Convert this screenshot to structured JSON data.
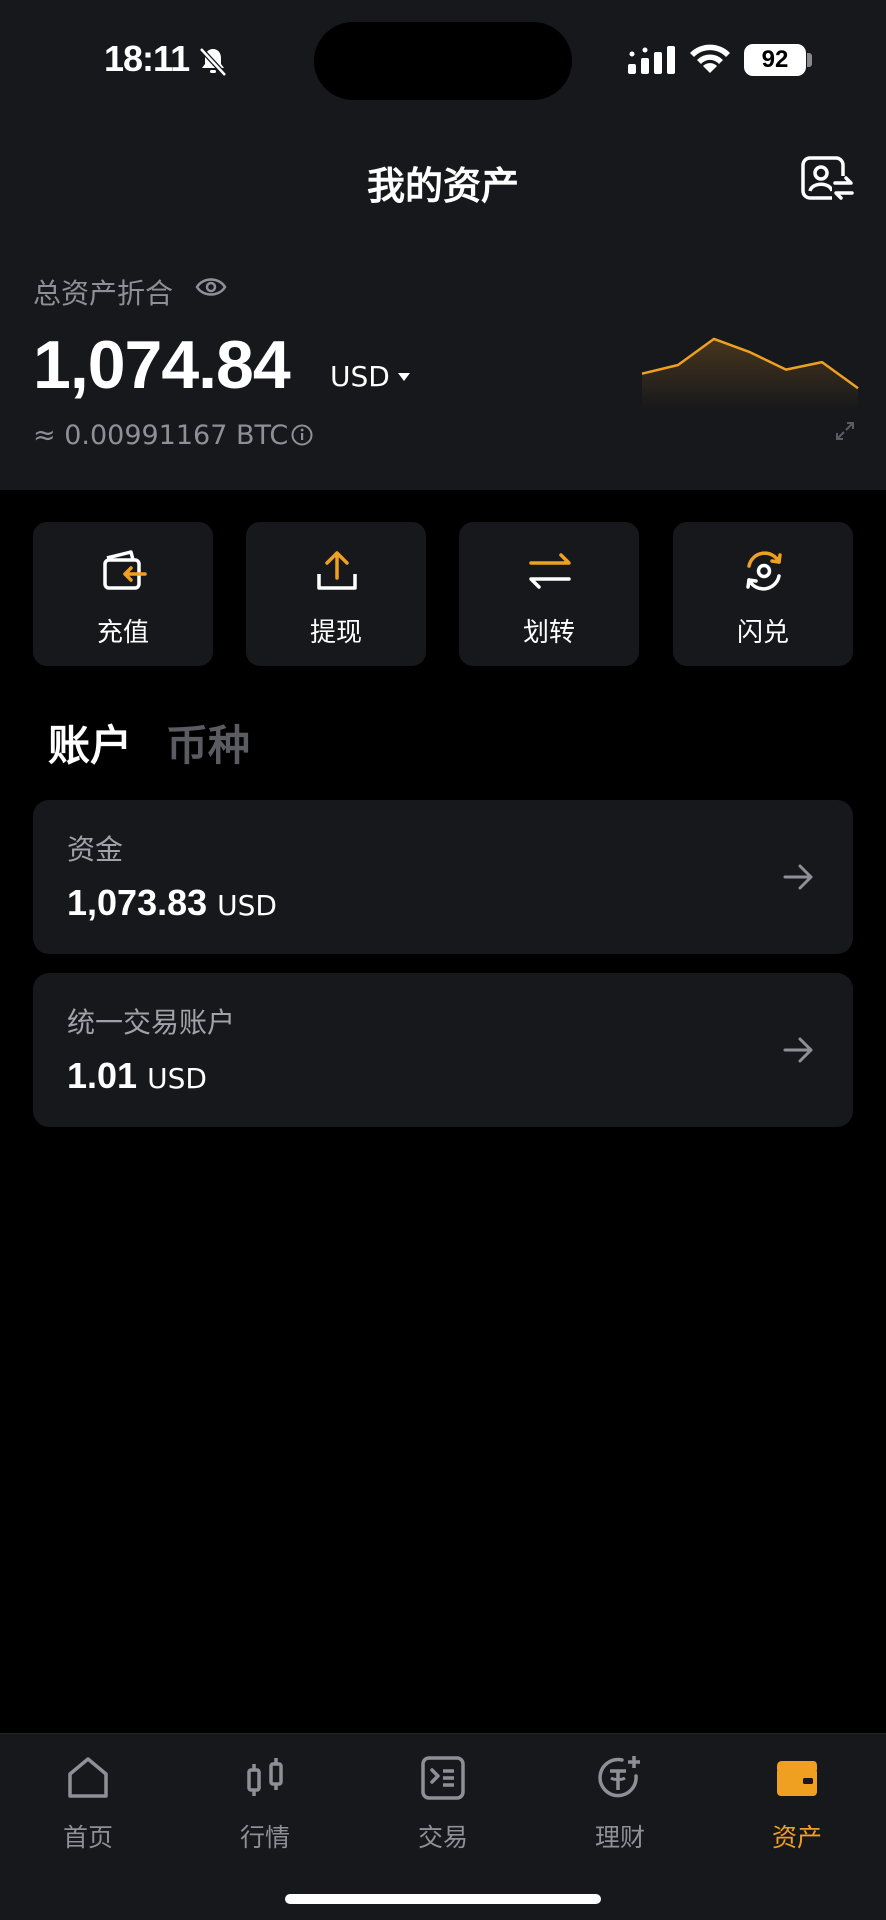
{
  "status_bar": {
    "time": "18:11",
    "battery": "92"
  },
  "header": {
    "title": "我的资产"
  },
  "summary": {
    "label": "总资产折合",
    "total": "1,074.84",
    "currency": "USD",
    "btc_equivalent": "≈ 0.00991167 BTC",
    "trend_values": [
      0.35,
      0.5,
      0.95,
      0.72,
      0.42,
      0.55,
      0.1
    ]
  },
  "actions": [
    {
      "label": "充值",
      "icon": "deposit-icon"
    },
    {
      "label": "提现",
      "icon": "withdraw-icon"
    },
    {
      "label": "划转",
      "icon": "transfer-icon"
    },
    {
      "label": "闪兑",
      "icon": "convert-icon"
    }
  ],
  "tabs": {
    "account": "账户",
    "coin": "币种"
  },
  "accounts": [
    {
      "name": "资金",
      "amount": "1,073.83",
      "unit": "USD"
    },
    {
      "name": "统一交易账户",
      "amount": "1.01",
      "unit": "USD"
    }
  ],
  "tabbar": [
    {
      "label": "首页",
      "icon": "home-icon"
    },
    {
      "label": "行情",
      "icon": "market-icon"
    },
    {
      "label": "交易",
      "icon": "trade-icon"
    },
    {
      "label": "理财",
      "icon": "earn-icon"
    },
    {
      "label": "资产",
      "icon": "wallet-icon"
    }
  ],
  "colors": {
    "accent": "#f0a020",
    "card": "#17181b",
    "muted": "#8e9095"
  }
}
